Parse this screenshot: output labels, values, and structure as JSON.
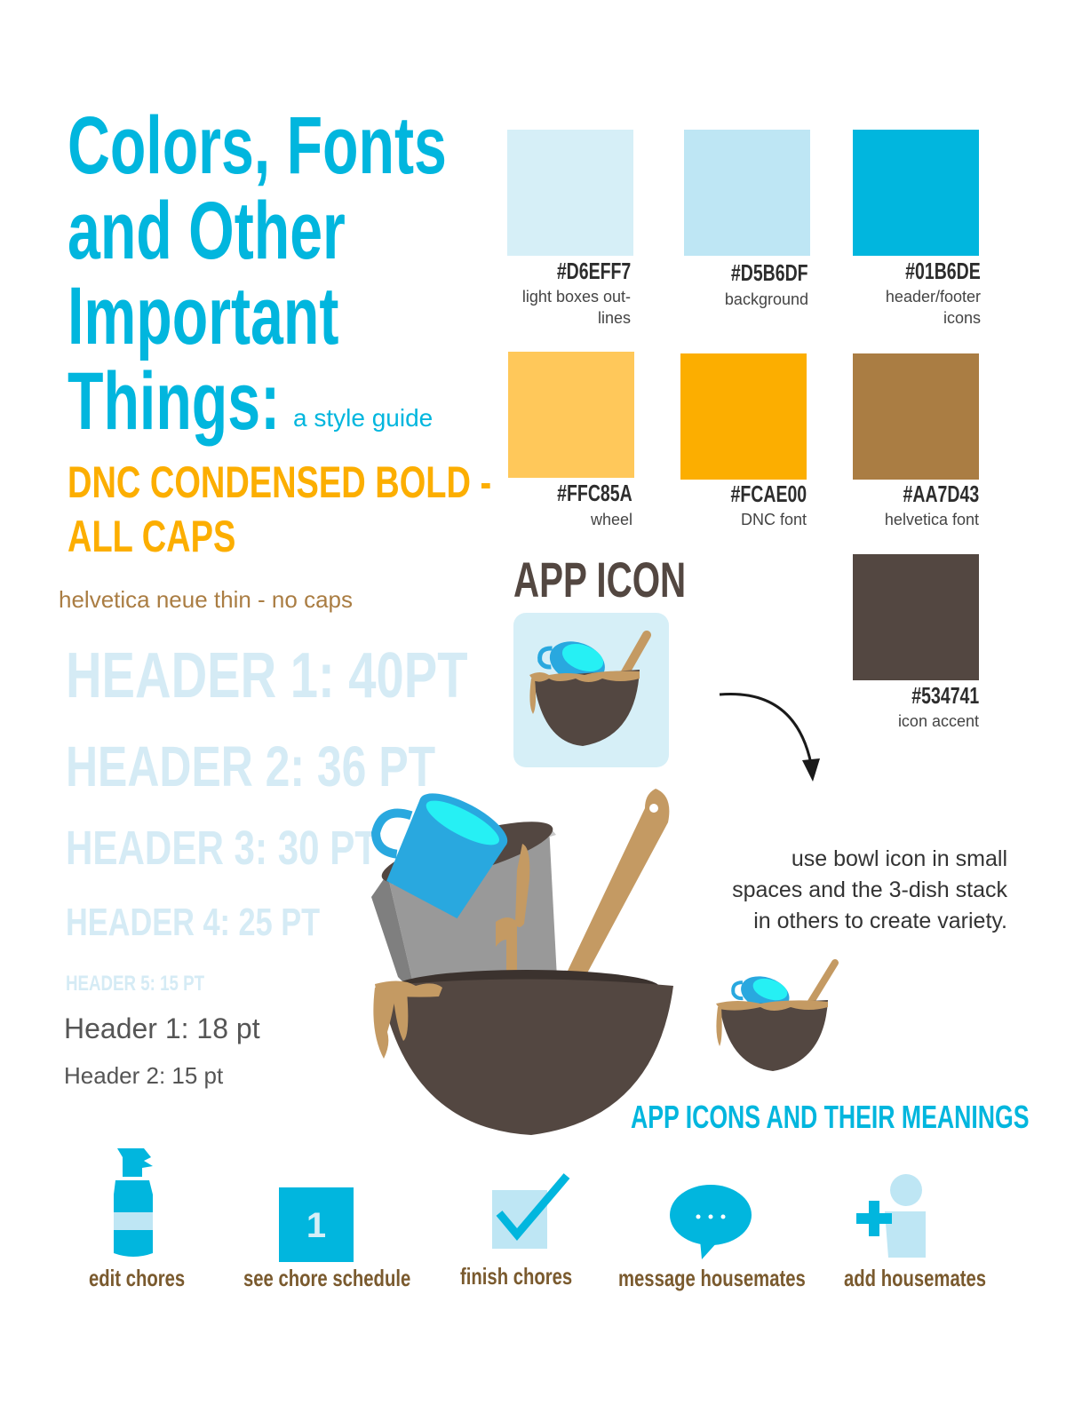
{
  "title": {
    "line1": "Colors, Fonts",
    "line2": "and Other",
    "line3": "Important",
    "line4": "Things:",
    "subtitle": "a style guide"
  },
  "fonts": {
    "dnc_line1": "DNC CONDENSED BOLD -",
    "dnc_line2": "ALL CAPS",
    "helvetica": "helvetica neue thin - no caps"
  },
  "headers": {
    "h1": "HEADER 1: 40PT",
    "h2": "HEADER 2: 36 PT",
    "h3": "HEADER 3: 30 PT",
    "h4": "HEADER 4: 25 PT",
    "h5": "HEADER 5: 15 PT",
    "plain1": "Header 1: 18 pt",
    "plain2": "Header 2: 15 pt"
  },
  "swatches": [
    {
      "hex": "#D6EFF7",
      "desc1": "light boxes  out-",
      "desc2": "lines",
      "color": "#D6EFF7"
    },
    {
      "hex": "#D5B6DF",
      "desc1": "background",
      "desc2": "",
      "color": "#BEE6F4"
    },
    {
      "hex": "#01B6DE",
      "desc1": "header/footer",
      "desc2": "icons",
      "color": "#01B6DE"
    },
    {
      "hex": "#FFC85A",
      "desc1": "wheel",
      "desc2": "",
      "color": "#FFC85A"
    },
    {
      "hex": "#FCAE00",
      "desc1": "DNC font",
      "desc2": "",
      "color": "#FCAE00"
    },
    {
      "hex": "#AA7D43",
      "desc1": "helvetica font",
      "desc2": "",
      "color": "#AA7D43"
    },
    {
      "hex": "#534741",
      "desc1": "icon accent",
      "desc2": "",
      "color": "#534741"
    }
  ],
  "app_icon": {
    "title": "APP  ICON",
    "note": "use bowl icon in small spaces and the 3-dish stack in others to create variety."
  },
  "meanings": {
    "title": "APP ICONS AND THEIR MEANINGS",
    "items": [
      {
        "label": "edit chores",
        "icon": "spray-bottle-icon"
      },
      {
        "label": "see chore schedule",
        "icon": "calendar-icon"
      },
      {
        "label": "finish chores",
        "icon": "checkbox-icon"
      },
      {
        "label": "message housemates",
        "icon": "chat-bubble-icon"
      },
      {
        "label": "add housemates",
        "icon": "add-person-icon"
      }
    ]
  }
}
